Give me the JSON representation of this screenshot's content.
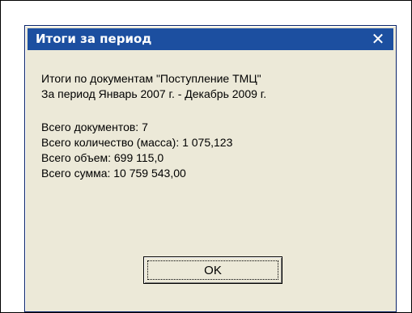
{
  "dialog": {
    "title": "Итоги за период",
    "close_symbol": "✕",
    "lines": {
      "header1": "Итоги по документам \"Поступление ТМЦ\"",
      "header2": "За период Январь 2007 г. - Декабрь 2009 г.",
      "total_docs": "Всего документов: 7",
      "total_qty": "Всего количество (масса): 1 075,123",
      "total_volume": "Всего объем: 699 115,0",
      "total_sum": "Всего сумма: 10 759 543,00"
    },
    "ok_label": "OK"
  },
  "colors": {
    "title_bar": "#1c4fa0",
    "dialog_bg": "#ece9d8"
  }
}
